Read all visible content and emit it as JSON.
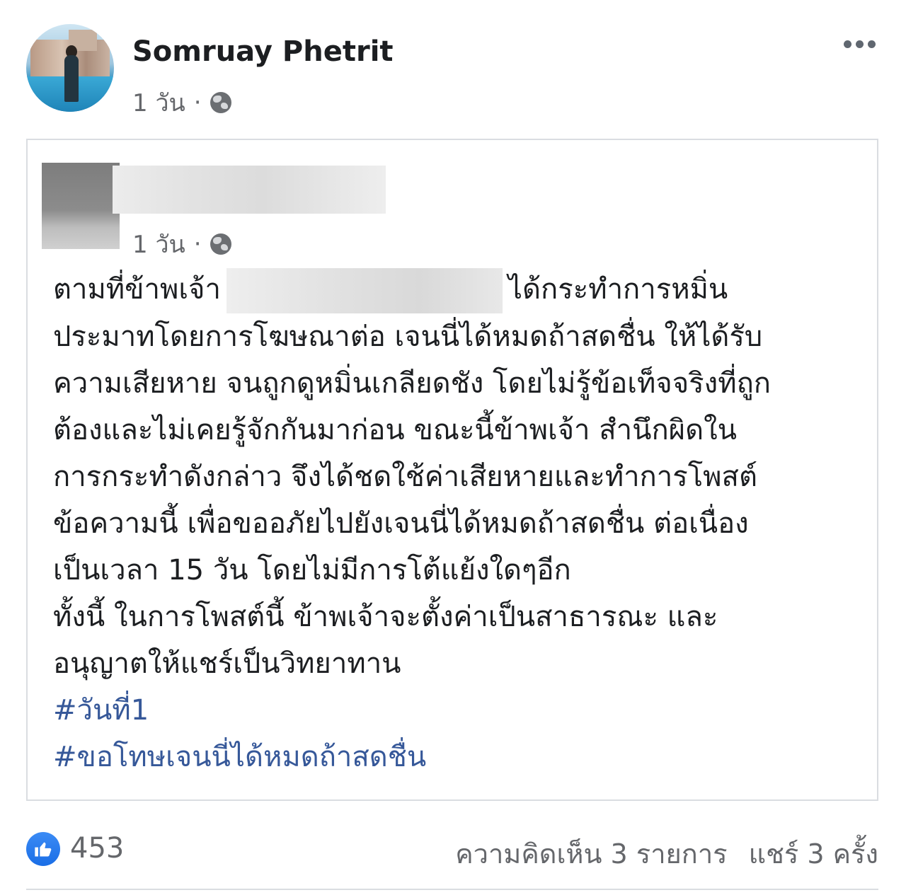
{
  "post": {
    "author": "Somruay Phetrit",
    "time": "1 วัน",
    "separator": "·",
    "privacy_icon": "globe-icon",
    "menu_icon": "more-options-icon"
  },
  "shared_post": {
    "time": "1 วัน",
    "separator": "·",
    "privacy_icon": "globe-icon",
    "text_start": "ตามที่ข้าพเจ้า",
    "text_after_redaction": "ได้กระทำการหมิ่น",
    "lines": [
      "ประมาทโดยการโฆษณาต่อ เจนนี่ได้หมดถ้าสดชื่น ให้ได้รับ",
      "ความเสียหาย จนถูกดูหมิ่นเกลียดชัง โดยไม่รู้ข้อเท็จจริงที่ถูก",
      "ต้องและไม่เคยรู้จักกันมาก่อน ขณะนี้ข้าพเจ้า สำนึกผิดใน",
      "การกระทำดังกล่าว จึงได้ชดใช้ค่าเสียหายและทำการโพสต์",
      "ข้อความนี้ เพื่อขออภัยไปยังเจนนี่ได้หมดถ้าสดชื่น ต่อเนื่อง",
      "เป็นเวลา 15 วัน โดยไม่มีการโต้แย้งใดๆอีก",
      "ทั้งนี้ ในการโพสต์นี้ ข้าพเจ้าจะตั้งค่าเป็นสาธารณะ และ",
      "อนุญาตให้แชร์เป็นวิทยาทาน"
    ],
    "hashtags": [
      "#วันที่1",
      "#ขอโทษเจนนี่ได้หมดถ้าสดชื่น"
    ]
  },
  "reactions": {
    "icon": "like-icon",
    "count": "453",
    "comments": "ความคิดเห็น 3 รายการ",
    "shares": "แชร์ 3 ครั้ง"
  },
  "colors": {
    "hashtag": "#365899",
    "secondary_text": "#65676b",
    "like_blue": "#1a6ee6"
  }
}
